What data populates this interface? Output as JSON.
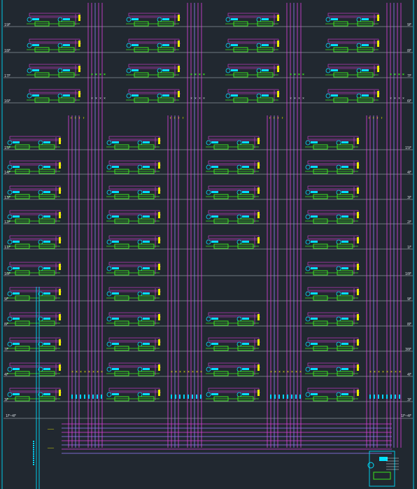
{
  "drawing": {
    "colors": {
      "background": "#212830",
      "floor_line": "#8a939b",
      "frame": "#00c8e6",
      "riser_magenta": "#e040e0",
      "riser_violet": "#9a7cff",
      "equipment_green": "#39e61c",
      "equipment_cyan": "#00e0ff",
      "connector_yellow": "#f0f000",
      "marker_cyan": "#00d6ff",
      "note_white": "#d8dde2"
    },
    "floor_labels": {
      "b1_left": [
        "19F",
        "18F",
        "17F",
        "16F"
      ],
      "b1_right": [
        "9F",
        "8F",
        "7F",
        "6F"
      ],
      "b2_left": [
        "15F",
        "14F",
        "13F",
        "12F",
        "11F"
      ],
      "b2_right": [
        "15F",
        "4F",
        "3F",
        "2F",
        "1F"
      ],
      "b3_left": [
        "10F",
        "9F",
        "8F",
        "7F",
        "4F",
        "3F"
      ],
      "b3_right": [
        "10F",
        "9F",
        "8F",
        "30F",
        "4F",
        "3F"
      ],
      "bottom_left": "1F~4F",
      "bottom_right": "1F~4F"
    },
    "icons": {
      "unit": "electric-meter-box-icon",
      "riser": "vertical-riser-line-icon",
      "connector": "yellow-terminal-icon"
    }
  }
}
